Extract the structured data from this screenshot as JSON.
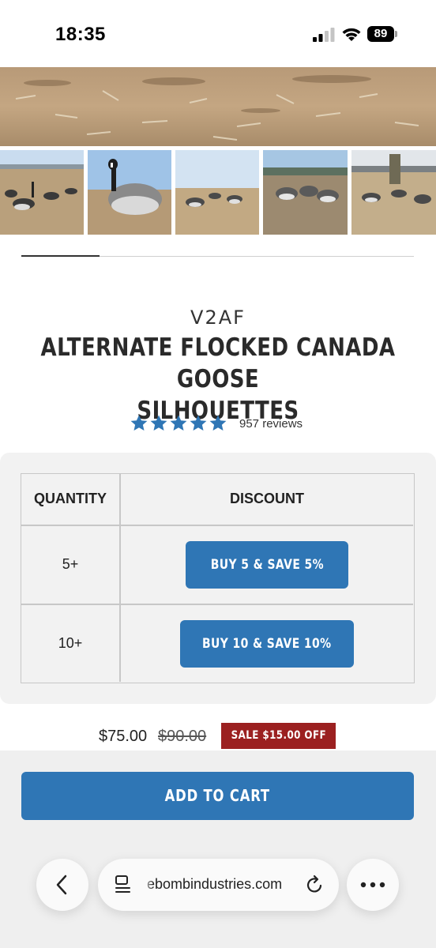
{
  "status_bar": {
    "time": "18:35",
    "battery": "89"
  },
  "images": {
    "hero": "field-with-corn-stubble",
    "thumbs": [
      "goose-decoys-in-field",
      "single-goose-decoy-closeup",
      "decoys-on-dirt-field",
      "decoy-group-closeup",
      "hunter-with-decoys"
    ]
  },
  "gallery_progress": 0.2,
  "product": {
    "brand": "V2AF",
    "title_line1": "ALTERNATE FLOCKED CANADA GOOSE",
    "title_line2": "SILHOUETTES",
    "rating": 5,
    "reviews": "957 reviews"
  },
  "discount_table": {
    "headers": {
      "quantity": "QUANTITY",
      "discount": "DISCOUNT"
    },
    "rows": [
      {
        "quantity": "5+",
        "button": "BUY 5 & SAVE 5%"
      },
      {
        "quantity": "10+",
        "button": "BUY 10 & SAVE 10%"
      }
    ]
  },
  "price": {
    "current": "$75.00",
    "original": "$90.00",
    "sale_badge": "SALE $15.00 OFF"
  },
  "cart": {
    "add_label": "ADD TO CART"
  },
  "browser": {
    "url": "ebombindustries.com"
  },
  "colors": {
    "accent": "#2f76b5",
    "sale": "#9b2020"
  }
}
